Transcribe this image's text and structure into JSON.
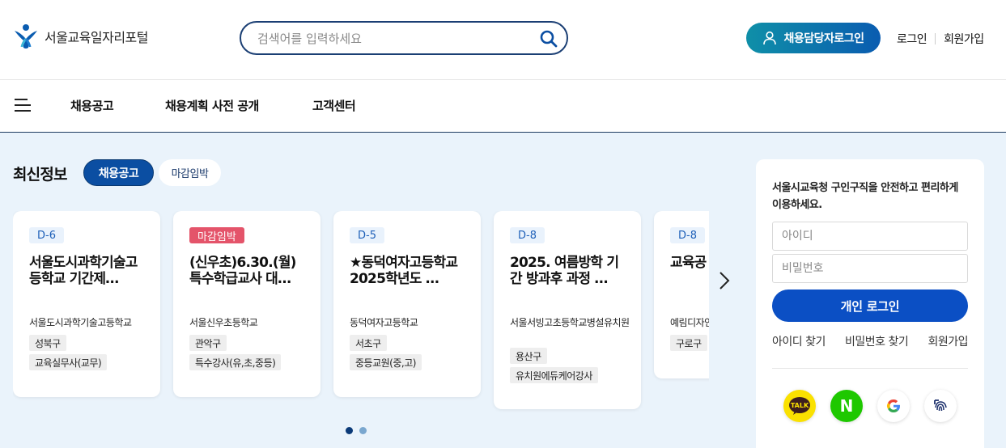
{
  "header": {
    "logo_text": "서울교육일자리포털",
    "search_placeholder": "검색어를 입력하세요",
    "hr_login_label": "채용담당자로그인",
    "login_link": "로그인",
    "signup_link": "회원가입"
  },
  "nav": {
    "items": [
      "채용공고",
      "채용계획 사전 공개",
      "고객센터"
    ]
  },
  "latest": {
    "title": "최신정보",
    "tabs": [
      {
        "label": "채용공고",
        "active": true
      },
      {
        "label": "마감임박",
        "active": false
      }
    ],
    "cards": [
      {
        "badge": "D-6",
        "urgent": false,
        "title": "서울도시과학기술고등학교 기간제…",
        "org": "서울도시과학기술고등학교",
        "region": "성북구",
        "job": "교육실무사(교무)"
      },
      {
        "badge": "마감임박",
        "urgent": true,
        "title": "(신우초)6.30.(월) 특수학급교사 대…",
        "org": "서울신우초등학교",
        "region": "관악구",
        "job": "특수강사(유,초,중등)"
      },
      {
        "badge": "D-5",
        "urgent": false,
        "title": "★동덕여자고등학교 2025학년도 …",
        "org": "동덕여자고등학교",
        "region": "서초구",
        "job": "중등교원(중,고)"
      },
      {
        "badge": "D-8",
        "urgent": false,
        "title": "2025. 여름방학 기간 방과후 과정 …",
        "org": "서울서빙고초등학교병설유치원",
        "region": "용산구",
        "job": "유치원에듀케어강사"
      },
      {
        "badge": "D-8",
        "urgent": false,
        "title": "교육공 호,당직",
        "org": "예림디자인",
        "region": "구로구",
        "job": ""
      }
    ],
    "pagination": {
      "current": 1,
      "total": 2
    }
  },
  "login_box": {
    "message": "서울시교육청 구인구직을 안전하고 편리하게 이용하세요.",
    "id_placeholder": "아이디",
    "pw_placeholder": "비밀번호",
    "login_button": "개인 로그인",
    "links": [
      "아이디 찾기",
      "비밀번호 찾기",
      "회원가입"
    ],
    "social": [
      {
        "name": "kakao",
        "label": "TALK",
        "color": "#fae100"
      },
      {
        "name": "naver",
        "label": "N",
        "color": "#1ec800"
      },
      {
        "name": "google",
        "label": "G",
        "color": "#ffffff"
      },
      {
        "name": "fingerprint",
        "label": "",
        "color": "#ffffff"
      }
    ]
  },
  "colors": {
    "brand_navy": "#0b4ea2",
    "urgent_red": "#e4546a",
    "main_bg": "#eaf3fb"
  }
}
